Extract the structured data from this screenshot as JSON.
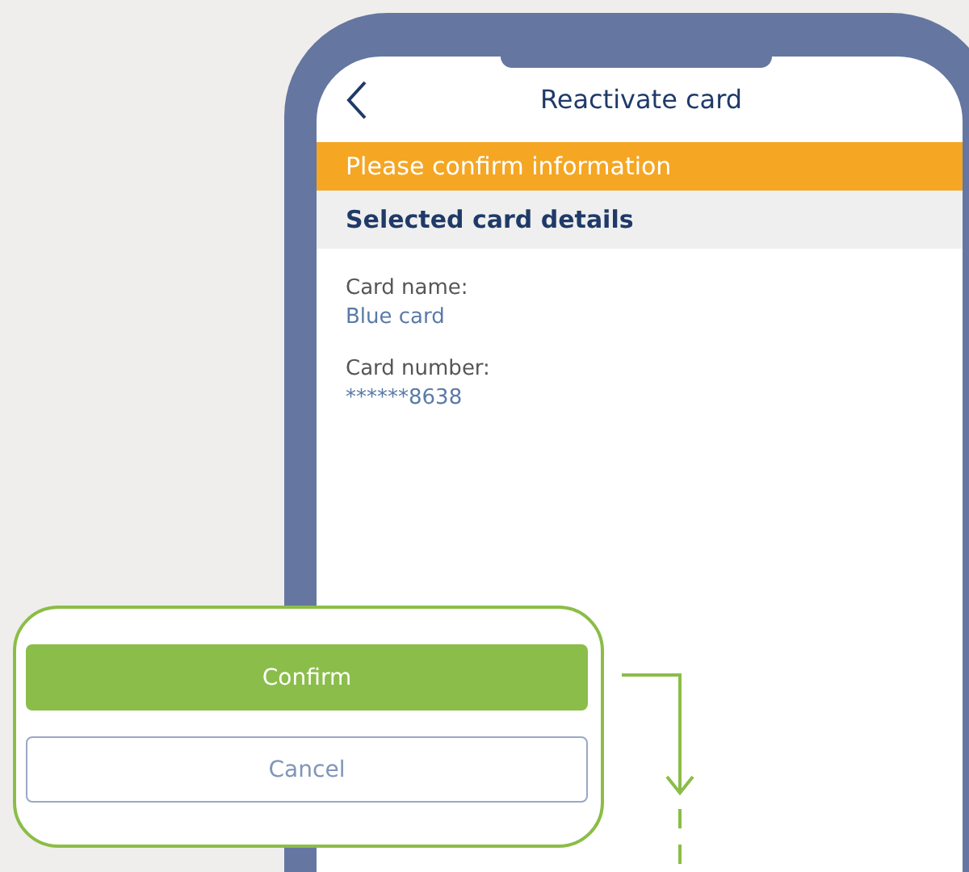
{
  "screen": {
    "title": "Reactivate card",
    "banner": "Please confirm information",
    "section_heading": "Selected card details",
    "fields": [
      {
        "label": "Card name:",
        "value": "Blue card"
      },
      {
        "label": "Card number:",
        "value": "******8638"
      }
    ]
  },
  "callout": {
    "buttons": [
      {
        "label": "Confirm",
        "kind": "primary"
      },
      {
        "label": "Cancel",
        "kind": "secondary"
      }
    ]
  }
}
